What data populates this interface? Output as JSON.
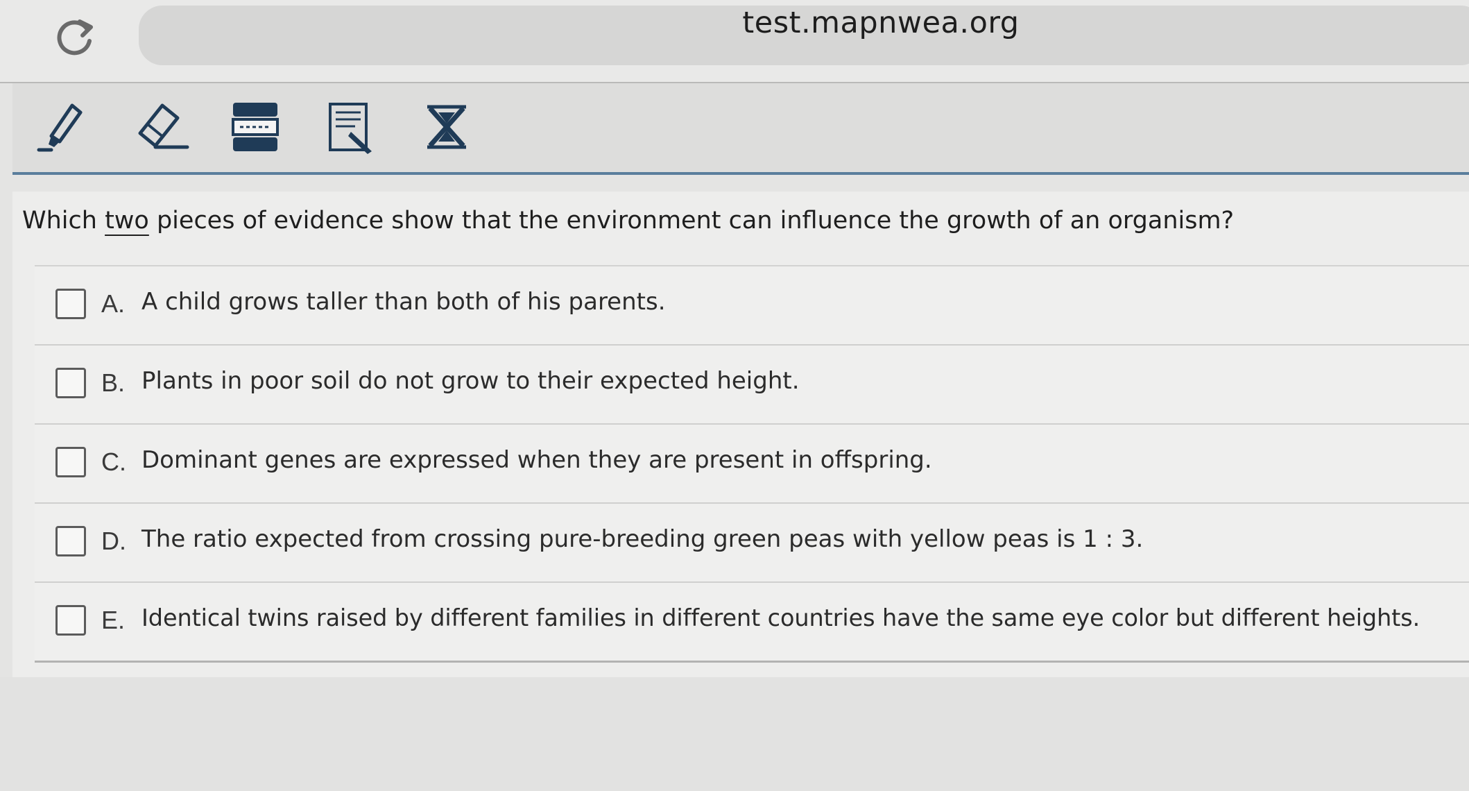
{
  "browser": {
    "url": "test.mapnwea.org",
    "reload_icon": "reload-icon"
  },
  "toolbar": {
    "tools": [
      {
        "name": "highlighter-tool",
        "icon": "highlighter-icon"
      },
      {
        "name": "eraser-tool",
        "icon": "eraser-icon"
      },
      {
        "name": "line-reader-tool",
        "icon": "line-reader-icon"
      },
      {
        "name": "notepad-tool",
        "icon": "notepad-pencil-icon"
      },
      {
        "name": "answer-eliminator-tool",
        "icon": "answer-eliminator-icon"
      }
    ],
    "accent_color": "#1f3b57"
  },
  "question": {
    "prefix": "Which ",
    "emphasis": "two",
    "suffix": " pieces of evidence show that the environment can influence the growth of an organism?"
  },
  "options": [
    {
      "letter": "A.",
      "text": "A child grows taller than both of his parents.",
      "checked": false
    },
    {
      "letter": "B.",
      "text": "Plants in poor soil do not grow to their expected height.",
      "checked": false
    },
    {
      "letter": "C.",
      "text": "Dominant genes are expressed when they are present in offspring.",
      "checked": false
    },
    {
      "letter": "D.",
      "text": "The ratio expected from crossing pure-breeding green peas with yellow peas is 1 : 3.",
      "checked": false
    },
    {
      "letter": "E.",
      "text": "Identical twins raised by different families in different countries have the same eye color but different heights.",
      "checked": false
    }
  ]
}
